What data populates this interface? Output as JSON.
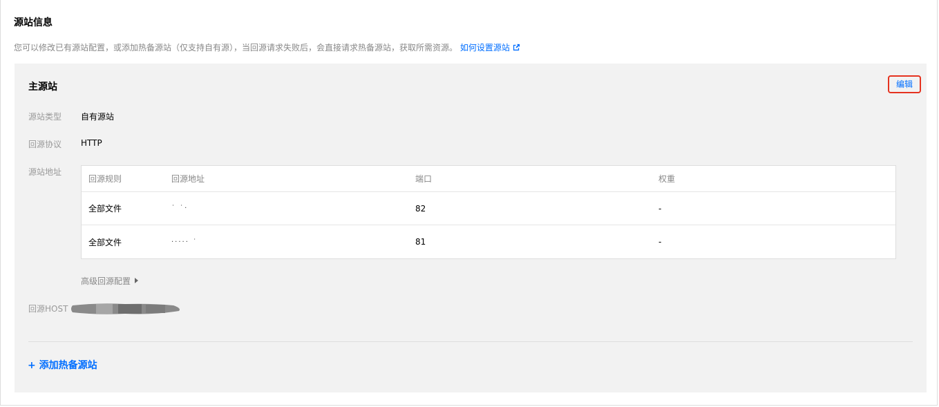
{
  "section": {
    "title": "源站信息",
    "description": "您可以修改已有源站配置，或添加热备源站（仅支持自有源），当回源请求失败后，会直接请求热备源站，获取所需资源。",
    "help_link": "如何设置源站"
  },
  "primary": {
    "title": "主源站",
    "edit_label": "编辑",
    "origin_type_label": "源站类型",
    "origin_type_value": "自有源站",
    "protocol_label": "回源协议",
    "protocol_value": "HTTP",
    "address_label": "源站地址",
    "table": {
      "headers": [
        "回源规则",
        "回源地址",
        "端口",
        "权重"
      ],
      "rows": [
        {
          "rule": "全部文件",
          "address": "˙    ˙·",
          "port": "82",
          "weight": "-"
        },
        {
          "rule": "全部文件",
          "address": "·····    ˙",
          "port": "81",
          "weight": "-"
        }
      ]
    },
    "advanced_label": "高级回源配置",
    "host_label": "回源HOST"
  },
  "add_backup_label": "+ 添加热备源站",
  "colors": {
    "accent": "#006eff",
    "highlight_border": "#e5321f",
    "panel_bg": "#f2f2f2"
  }
}
